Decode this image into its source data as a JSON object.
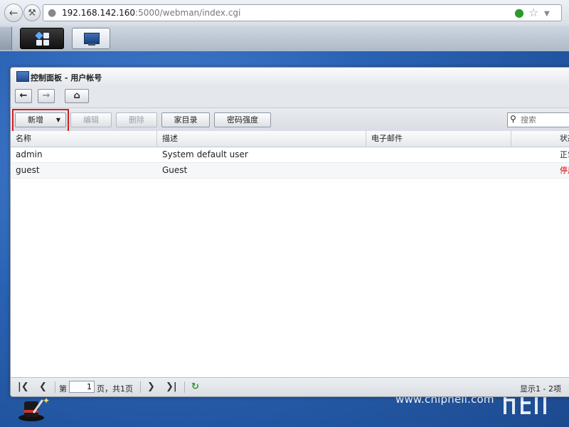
{
  "browser": {
    "url_host": "192.168.142.160",
    "url_rest": ":5000/webman/index.cgi"
  },
  "window": {
    "title": "控制面板 - 用户帐号"
  },
  "toolbar": {
    "add_label": "新增",
    "edit_label": "编辑",
    "delete_label": "删除",
    "home_dir_label": "家目录",
    "password_strength_label": "密码强度",
    "search_placeholder": "搜索"
  },
  "table": {
    "columns": [
      "名称",
      "描述",
      "电子邮件",
      "状态"
    ],
    "rows": [
      {
        "name": "admin",
        "description": "System default user",
        "email": "",
        "status": "正常",
        "status_kind": "ok"
      },
      {
        "name": "guest",
        "description": "Guest",
        "email": "",
        "status": "停用",
        "status_kind": "off"
      }
    ]
  },
  "pager": {
    "page_prefix": "第",
    "page_value": "1",
    "page_suffix": "页，共1页",
    "summary": "显示1 - 2项"
  },
  "watermark": {
    "text": "www.chiphell.com"
  },
  "colors": {
    "highlight": "#d41e1e",
    "status_off": "#cc1111"
  }
}
